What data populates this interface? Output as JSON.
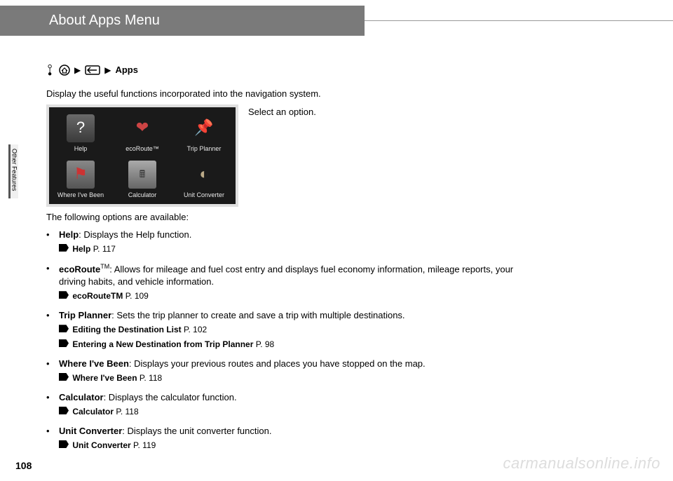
{
  "header": {
    "title": "About Apps Menu"
  },
  "nav_path": {
    "apps_label": "Apps"
  },
  "intro": "Display the useful functions incorporated into the navigation system.",
  "side_instruction": "Select an option.",
  "screenshot": {
    "cells": [
      {
        "label": "Help",
        "glyph": "?"
      },
      {
        "label": "ecoRoute™",
        "glyph": "❤"
      },
      {
        "label": "Trip Planner",
        "glyph": "📌"
      },
      {
        "label": "Where I've Been",
        "glyph": "⚑"
      },
      {
        "label": "Calculator",
        "glyph": "🖩"
      },
      {
        "label": "Unit Converter",
        "glyph": "◐"
      }
    ]
  },
  "options_intro": "The following options are available:",
  "options": [
    {
      "title": "Help",
      "desc": ": Displays the Help function.",
      "refs": [
        {
          "text": "Help",
          "page": "P. 117"
        }
      ]
    },
    {
      "title": "ecoRoute",
      "tm": "TM",
      "desc": ": Allows for mileage and fuel cost entry and displays fuel economy information, mileage reports, your driving habits, and vehicle information.",
      "refs": [
        {
          "text": "ecoRouteTM",
          "page": "P. 109"
        }
      ]
    },
    {
      "title": "Trip Planner",
      "desc": ": Sets the trip planner to create and save a trip with multiple destinations.",
      "refs": [
        {
          "text": "Editing the Destination List",
          "page": "P. 102"
        },
        {
          "text": "Entering a New Destination from Trip Planner",
          "page": "P. 98"
        }
      ]
    },
    {
      "title": "Where I've Been",
      "desc": ": Displays your previous routes and places you have stopped on the map.",
      "refs": [
        {
          "text": "Where I've Been",
          "page": "P. 118"
        }
      ]
    },
    {
      "title": "Calculator",
      "desc": ": Displays the calculator function.",
      "refs": [
        {
          "text": "Calculator",
          "page": "P. 118"
        }
      ]
    },
    {
      "title": "Unit Converter",
      "desc": ": Displays the unit converter function.",
      "refs": [
        {
          "text": "Unit Converter",
          "page": "P. 119"
        }
      ]
    }
  ],
  "sidebar_label": "Other Features",
  "page_number": "108",
  "watermark": "carmanualsonline.info"
}
